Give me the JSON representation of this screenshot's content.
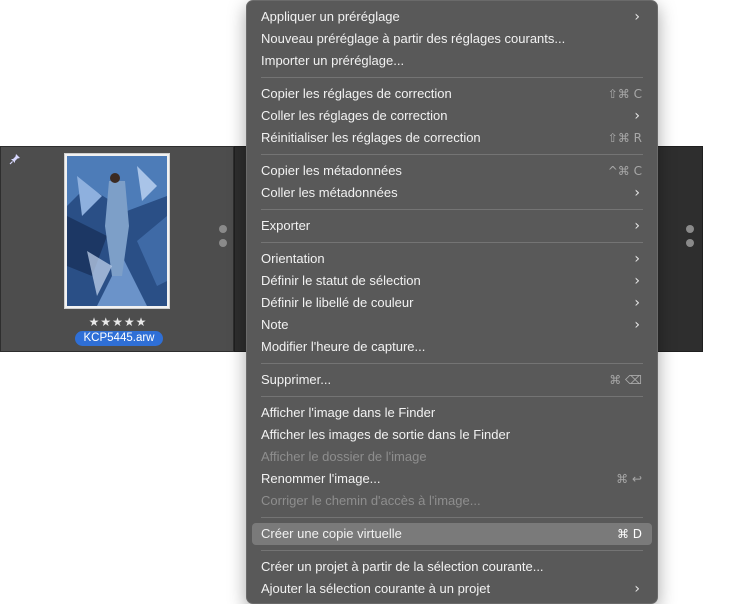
{
  "browser": {
    "filename": "KCP5445.arw",
    "rating": "★★★★★"
  },
  "menu": {
    "groups": [
      [
        {
          "label": "Appliquer un préréglage",
          "submenu": true
        },
        {
          "label": "Nouveau préréglage à partir des réglages courants..."
        },
        {
          "label": "Importer un préréglage..."
        }
      ],
      [
        {
          "label": "Copier les réglages de correction",
          "shortcut": "⇧⌘ C"
        },
        {
          "label": "Coller les réglages de correction",
          "submenu": true
        },
        {
          "label": "Réinitialiser les réglages de correction",
          "shortcut": "⇧⌘ R"
        }
      ],
      [
        {
          "label": "Copier les métadonnées",
          "shortcut": "^⌘ C"
        },
        {
          "label": "Coller les métadonnées",
          "submenu": true
        }
      ],
      [
        {
          "label": "Exporter",
          "submenu": true
        }
      ],
      [
        {
          "label": "Orientation",
          "submenu": true
        },
        {
          "label": "Définir le statut de sélection",
          "submenu": true
        },
        {
          "label": "Définir le libellé de couleur",
          "submenu": true
        },
        {
          "label": "Note",
          "submenu": true
        },
        {
          "label": "Modifier l'heure de capture..."
        }
      ],
      [
        {
          "label": "Supprimer...",
          "shortcut": "⌘ ⌫"
        }
      ],
      [
        {
          "label": "Afficher l'image dans le Finder"
        },
        {
          "label": "Afficher les images de sortie dans le Finder"
        },
        {
          "label": "Afficher le dossier de l'image",
          "disabled": true
        },
        {
          "label": "Renommer l'image...",
          "shortcut": "⌘ ↩"
        },
        {
          "label": "Corriger le chemin d'accès à l'image...",
          "disabled": true
        }
      ],
      [
        {
          "label": "Créer une copie virtuelle",
          "shortcut": "⌘ D",
          "highlighted": true
        }
      ],
      [
        {
          "label": "Créer un projet à partir de la sélection courante..."
        },
        {
          "label": "Ajouter la sélection courante à un projet",
          "submenu": true
        }
      ]
    ],
    "submenu_arrow": "›"
  },
  "colors": {
    "menu_bg": "#595959",
    "highlight": "#7a7a7a",
    "selection_blue": "#2f6fd6"
  }
}
